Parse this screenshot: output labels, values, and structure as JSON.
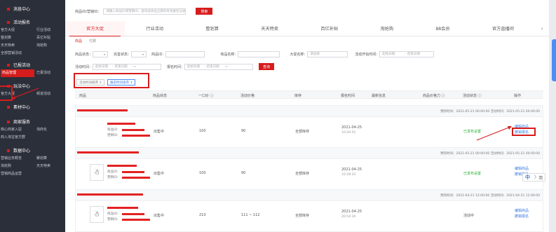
{
  "sidebar": {
    "sections": [
      {
        "title": "消息中心",
        "links": []
      },
      {
        "title": "活动报名",
        "links": [
          "官方大促",
          "行业活动",
          "整划算",
          "百亿补贴",
          "天天特卖",
          "淘抢购",
          "全部营销活动"
        ]
      },
      {
        "title": "已报活动",
        "links": [
          "商品管理",
          "已报活动"
        ]
      },
      {
        "title": "玩法中心",
        "links": [
          "官方大促",
          "频道活动"
        ]
      },
      {
        "title": "素材中心",
        "links": []
      },
      {
        "title": "商家服务",
        "links": [
          "核心商家入驻",
          "淘商化",
          "商入淘宝官方群"
        ]
      },
      {
        "title": "数据中心",
        "links": [
          "营销业务概览",
          "聚划算",
          "淘抢购",
          "天天特卖",
          "营销商品运营"
        ]
      }
    ]
  },
  "search": {
    "label": "商品ID/营销ID：",
    "placeholder": "请输入商品ID或营销ID，查询该商品全部的有效报名记录",
    "button": "搜索"
  },
  "tabs": [
    "官方大促",
    "行业活动",
    "整划算",
    "天天特卖",
    "百亿补贴",
    "淘抢购",
    "88会员",
    "官方直播间"
  ],
  "tab_more": "›",
  "subtabs": [
    "商品",
    "付费"
  ],
  "filters": {
    "row1": [
      {
        "label": "商品状态：",
        "value": ""
      },
      {
        "label": "完善状态：",
        "value": ""
      },
      {
        "label": "商品ID：",
        "value": ""
      },
      {
        "label": "商品名称：",
        "value": ""
      },
      {
        "label": "大促名称：",
        "value": "请选择"
      },
      {
        "label": "活动开始时间：",
        "value": "起始日期",
        "value2": "结束日期"
      }
    ],
    "row2": [
      {
        "label": "活动时间：",
        "value": "起始日期",
        "value2": "结束日期"
      },
      {
        "label": "报名时间：",
        "value": "起始日期",
        "value2": "结束日期"
      }
    ],
    "query_button": "查询"
  },
  "sort_buttons": [
    "活动时间排序 ⇕",
    "报名时间排序 ⇕"
  ],
  "table": {
    "headers": [
      "商品",
      "商品状态",
      "一口价 ⓘ",
      "活动价格",
      "库存",
      "报名时间",
      "最新信息",
      "商品价格力 ⓘ",
      "活动状态 ⓘ",
      "操作"
    ]
  },
  "rows": [
    {
      "period": "预热时间：2021-05-21 00:00:00    活动时间：2021-05-21 00:00:00",
      "product_label": "商品ID：",
      "marketing_label": "营销ID：",
      "status": "出售中",
      "price": "100",
      "activity_price": "90",
      "stock": "全部库存",
      "signup_date": "2021-04-25",
      "signup_time": "10:29:55",
      "activity_status": "已发布设置",
      "action1": "编辑商品",
      "action2": "撤销报名"
    },
    {
      "period": "预热时间：2021-05-21 00:00:00    活动时间：2021-05-21 00:00:00",
      "product_label": "商品ID：",
      "marketing_label": "营销ID：",
      "status": "出售中",
      "price": "100",
      "activity_price": "90",
      "stock": "全部库存",
      "signup_date": "2021-04-25",
      "signup_time": "10:28:10",
      "activity_status": "已发布设置",
      "action1": "编辑商品",
      "action2": "撤销报名"
    },
    {
      "period": "预热时间：2021-04-21 12:00:00    活动时间：2021-04-21 12:00:00",
      "product_label": "商品ID：",
      "marketing_label": "营销ID：",
      "status": "出售中",
      "price": "210",
      "activity_price": "111 ~ 112",
      "stock": "全部库存",
      "signup_date": "2021-04-25",
      "signup_time": "20:54:16",
      "activity_status": "活动中",
      "action1": "编辑商品",
      "action2": "撤销报名"
    }
  ],
  "ime": {
    "mode": "中",
    "moon": "☽",
    "script": "简"
  },
  "colors": {
    "accent": "#d61c1c",
    "link": "#3b7be0",
    "success": "#2fae3a",
    "sidebar_bg": "#2b2f3a"
  }
}
